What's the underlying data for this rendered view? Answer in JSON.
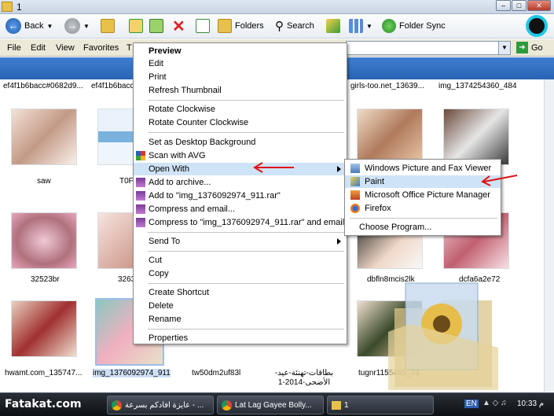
{
  "window": {
    "title": "1"
  },
  "toolbar": {
    "back": "Back",
    "folders": "Folders",
    "search": "Search",
    "folder_sync": "Folder Sync"
  },
  "menubar": {
    "items": [
      "File",
      "Edit",
      "View",
      "Favorites",
      "T"
    ],
    "go": "Go"
  },
  "files": {
    "top_labels": [
      "ef4f1b6bacc#0682d9...",
      "ef4f1b6bacc",
      "girls-too.net_13639...",
      "img_1374254360_484"
    ],
    "row1": [
      "saw",
      "T0F",
      "",
      ""
    ],
    "row2": [
      "32523br",
      "3263",
      "dbfln8mcis2lk",
      "dcfa6a2e72"
    ],
    "row3": [
      "hwamt.com_135747...",
      "img_1376092974_911",
      "tw50dm2uf83l",
      "بطاقات-تهنئة-عيد-الأضحى-2014-1",
      "tugnr1155485_73"
    ]
  },
  "context_menu": {
    "items": [
      "Preview",
      "Edit",
      "Print",
      "Refresh Thumbnail",
      "Rotate Clockwise",
      "Rotate Counter Clockwise",
      "Set as Desktop Background",
      "Scan with AVG",
      "Open With",
      "Add to archive...",
      "Add to \"img_1376092974_911.rar\"",
      "Compress and email...",
      "Compress to \"img_1376092974_911.rar\" and email",
      "Send To",
      "Cut",
      "Copy",
      "Create Shortcut",
      "Delete",
      "Rename",
      "Properties"
    ]
  },
  "submenu": {
    "items": [
      "Windows Picture and Fax Viewer",
      "Paint",
      "Microsoft Office Picture Manager",
      "Firefox",
      "Choose Program..."
    ]
  },
  "taskbar": {
    "brand": "Fatakat.com",
    "buttons": [
      "عايزة افادكم بسرعة - ...",
      "Lat Lag Gayee Bolly...",
      "1"
    ],
    "lang": "EN",
    "clock": "10:33 م"
  },
  "colors": {
    "highlight": "#cfe3f7",
    "band": "#2a63b3",
    "arrow": "#e01010"
  }
}
